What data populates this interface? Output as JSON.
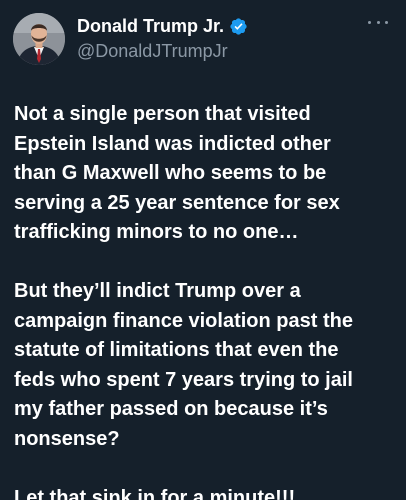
{
  "author": {
    "display_name": "Donald Trump Jr.",
    "handle": "@DonaldJTrumpJr",
    "verified_icon": "verified-badge-icon",
    "avatar_icon": "profile-avatar"
  },
  "menu": {
    "more_icon": "more-options-icon"
  },
  "tweet": {
    "paragraphs": [
      "Not a single person that visited\nEpstein Island was indicted other\nthan G Maxwell who seems to be\nserving a 25 year sentence for sex\ntrafficking minors to no one…",
      "But they’ll indict Trump over a\ncampaign finance violation past the\nstatute of limitations that even the\nfeds who spent 7 years trying to jail\nmy father passed on because it’s\nnonsense?",
      "Let that sink in for a minute!!!"
    ]
  },
  "colors": {
    "background": "#15202b",
    "text": "#ffffff",
    "secondary_text": "#8b98a5",
    "verified": "#1d9bf0"
  }
}
